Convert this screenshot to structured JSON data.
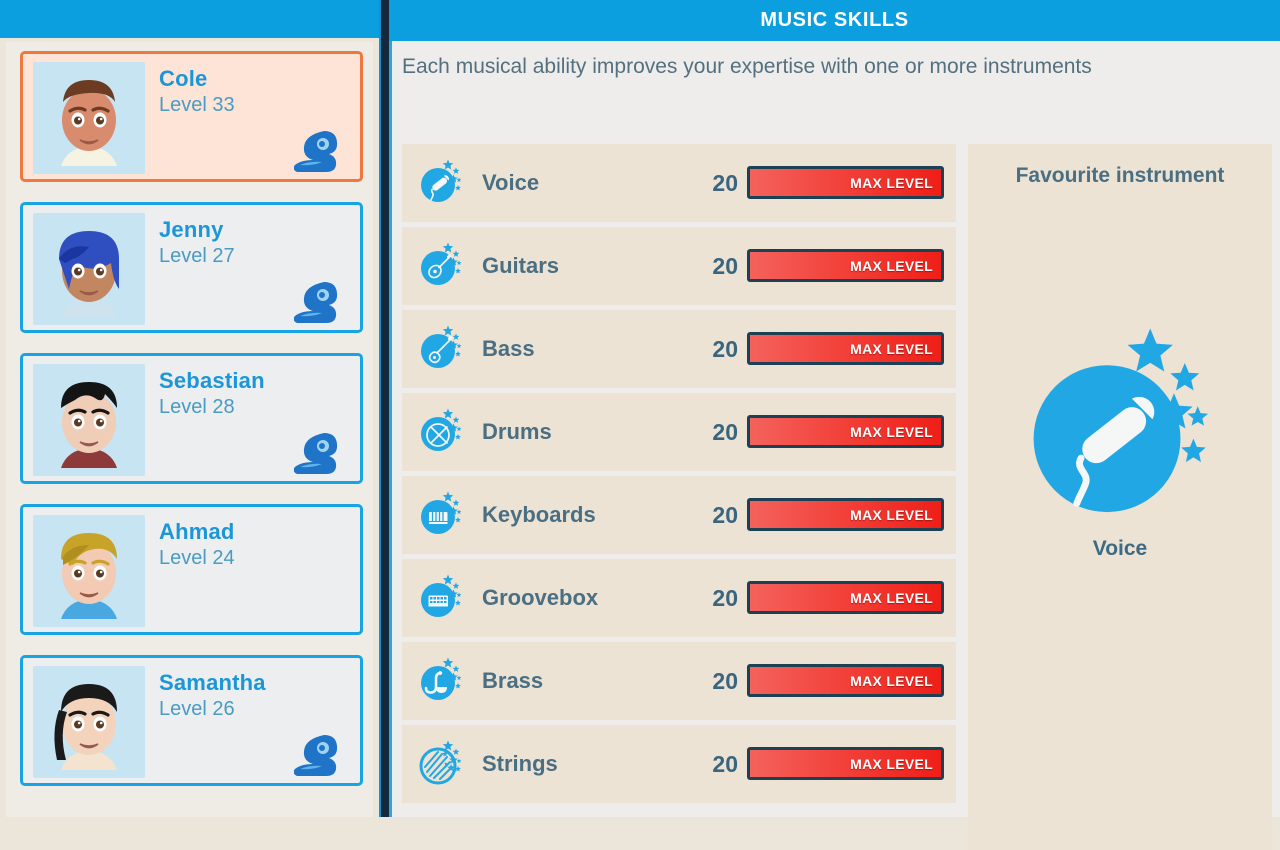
{
  "header": {
    "title": "MUSIC SKILLS",
    "subtitle": "Each musical ability improves your expertise with one or more instruments",
    "accent_color": "#0c9fe0",
    "panel_color": "#ece3d5"
  },
  "sidebar": {
    "characters": [
      {
        "name": "Cole",
        "level_label": "Level 33",
        "selected": true,
        "has_badge": true,
        "portrait": "cole",
        "hair": "#6b3b22",
        "skin": "#d98b6e",
        "shirt": "#f7f3e2",
        "bg": "#c6e4f2"
      },
      {
        "name": "Jenny",
        "level_label": "Level 27",
        "selected": false,
        "has_badge": true,
        "portrait": "jenny",
        "hair": "#2f4fc0",
        "skin": "#c28760",
        "shirt": "#cfe3ee",
        "bg": "#c6e4f2"
      },
      {
        "name": "Sebastian",
        "level_label": "Level 28",
        "selected": false,
        "has_badge": true,
        "portrait": "sebastian",
        "hair": "#141414",
        "skin": "#f0cdb6",
        "shirt": "#8e3a3a",
        "bg": "#c6e4f2"
      },
      {
        "name": "Ahmad",
        "level_label": "Level 24",
        "selected": false,
        "has_badge": false,
        "portrait": "ahmad",
        "hair": "#c8a32a",
        "skin": "#f3cbb4",
        "shirt": "#4aa8e0",
        "bg": "#c6e4f2"
      },
      {
        "name": "Samantha",
        "level_label": "Level 26",
        "selected": false,
        "has_badge": true,
        "portrait": "samantha",
        "hair": "#1a1a1a",
        "skin": "#f4d3bc",
        "shirt": "#f4e3cf",
        "bg": "#c6e4f2"
      }
    ]
  },
  "skills": {
    "max_label": "MAX LEVEL",
    "items": [
      {
        "name": "Voice",
        "value": "20",
        "icon": "microphone-icon",
        "progress": 100
      },
      {
        "name": "Guitars",
        "value": "20",
        "icon": "guitar-icon",
        "progress": 100
      },
      {
        "name": "Bass",
        "value": "20",
        "icon": "bass-guitar-icon",
        "progress": 100
      },
      {
        "name": "Drums",
        "value": "20",
        "icon": "drums-icon",
        "progress": 100
      },
      {
        "name": "Keyboards",
        "value": "20",
        "icon": "piano-icon",
        "progress": 100
      },
      {
        "name": "Groovebox",
        "value": "20",
        "icon": "groovebox-icon",
        "progress": 100
      },
      {
        "name": "Brass",
        "value": "20",
        "icon": "saxophone-icon",
        "progress": 100
      },
      {
        "name": "Strings",
        "value": "20",
        "icon": "strings-icon",
        "progress": 100
      }
    ]
  },
  "favourite": {
    "title": "Favourite instrument",
    "name": "Voice",
    "icon": "microphone-icon"
  }
}
